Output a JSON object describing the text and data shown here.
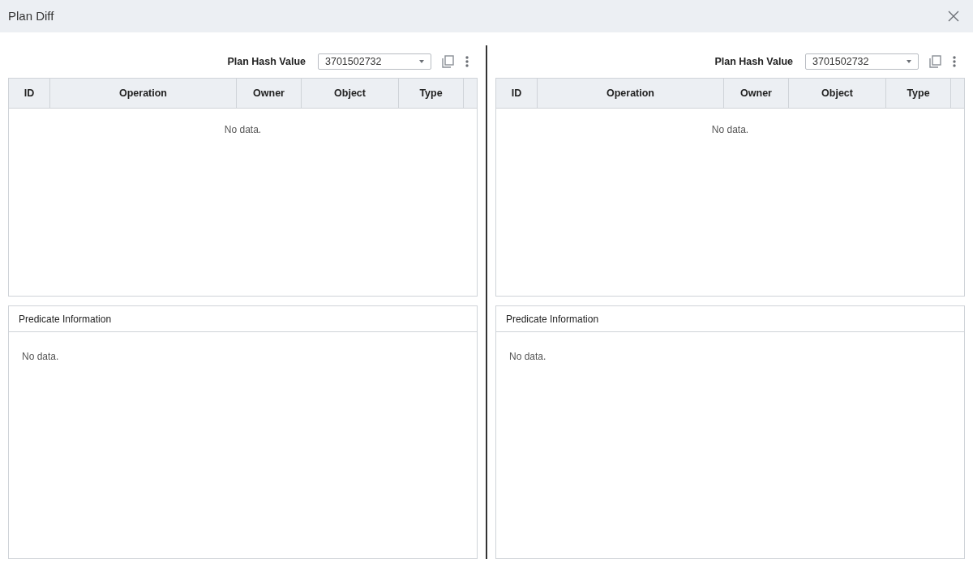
{
  "window": {
    "title": "Plan Diff"
  },
  "panes": [
    {
      "plan_hash": {
        "label": "Plan Hash Value",
        "value": "3701502732"
      },
      "table": {
        "columns": [
          "ID",
          "Operation",
          "Owner",
          "Object",
          "Type"
        ],
        "empty_text": "No data."
      },
      "predicate": {
        "title": "Predicate Information",
        "empty_text": "No data."
      }
    },
    {
      "plan_hash": {
        "label": "Plan Hash Value",
        "value": "3701502732"
      },
      "table": {
        "columns": [
          "ID",
          "Operation",
          "Owner",
          "Object",
          "Type"
        ],
        "empty_text": "No data."
      },
      "predicate": {
        "title": "Predicate Information",
        "empty_text": "No data."
      }
    }
  ]
}
